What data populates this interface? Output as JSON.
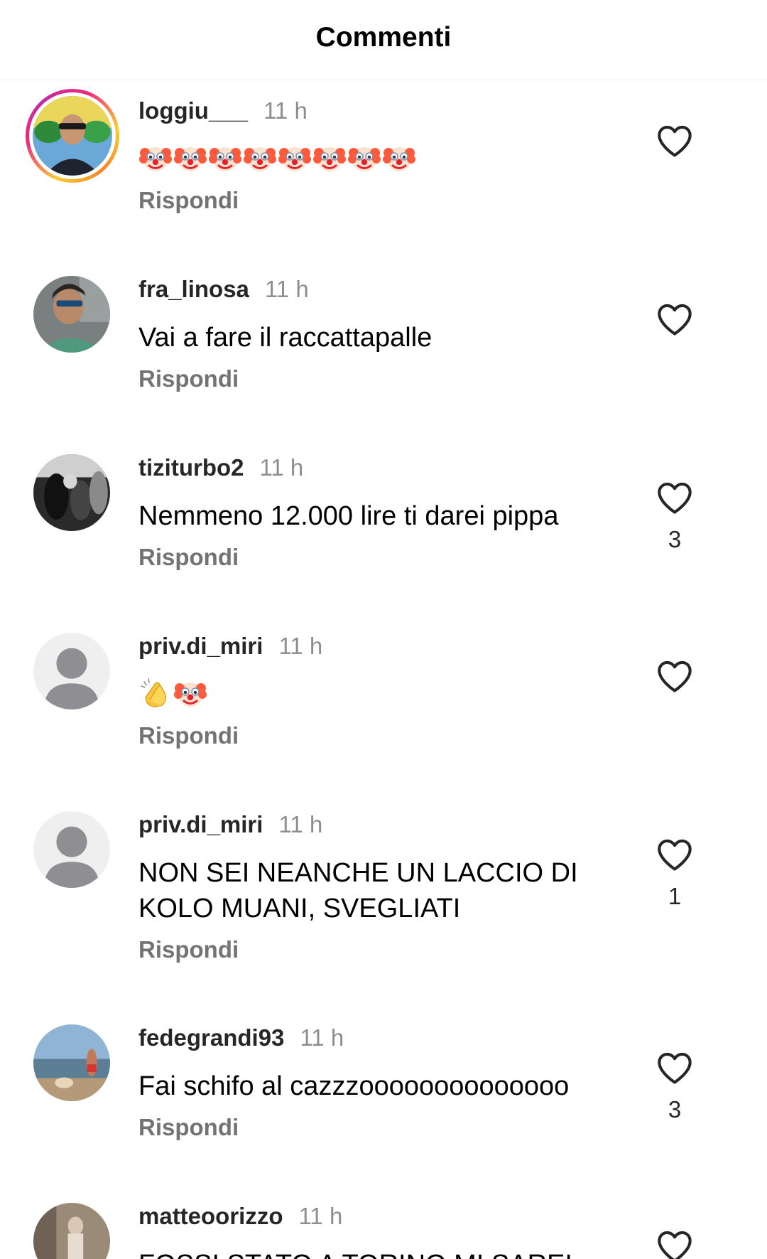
{
  "header": {
    "title": "Commenti"
  },
  "colors": {
    "like_outline": "#262626",
    "secondary_text": "#8e8e8e",
    "reply_text": "#737373"
  },
  "comments": [
    {
      "username": "loggiu___",
      "time": "11 h",
      "text": "🤡🤡🤡🤡🤡🤡🤡🤡",
      "emojis": [
        "clown-face",
        "clown-face",
        "clown-face",
        "clown-face",
        "clown-face",
        "clown-face",
        "clown-face",
        "clown-face"
      ],
      "reply": "Rispondi",
      "likes": ""
    },
    {
      "username": "fra_linosa",
      "time": "11 h",
      "text": "Vai a fare il raccattapalle",
      "reply": "Rispondi",
      "likes": ""
    },
    {
      "username": "tiziturbo2",
      "time": "11 h",
      "text": "Nemmeno 12.000 lire ti darei pippa",
      "reply": "Rispondi",
      "likes": "3"
    },
    {
      "username": "priv.di_miri",
      "time": "11 h",
      "text": "👏🤡",
      "emojis": [
        "clapping-hands",
        "clown-face"
      ],
      "reply": "Rispondi",
      "likes": ""
    },
    {
      "username": "priv.di_miri",
      "time": "11 h",
      "text": "NON SEI NEANCHE UN LACCIO DI KOLO MUANI, SVEGLIATI",
      "reply": "Rispondi",
      "likes": "1"
    },
    {
      "username": "fedegrandi93",
      "time": "11 h",
      "text": "Fai schifo al cazzzoooooooooooooo",
      "reply": "Rispondi",
      "likes": "3"
    },
    {
      "username": "matteoorizzo",
      "time": "11 h",
      "text": "FOSSI STATO A TORINO MI SAREI",
      "reply": "",
      "likes": ""
    }
  ]
}
